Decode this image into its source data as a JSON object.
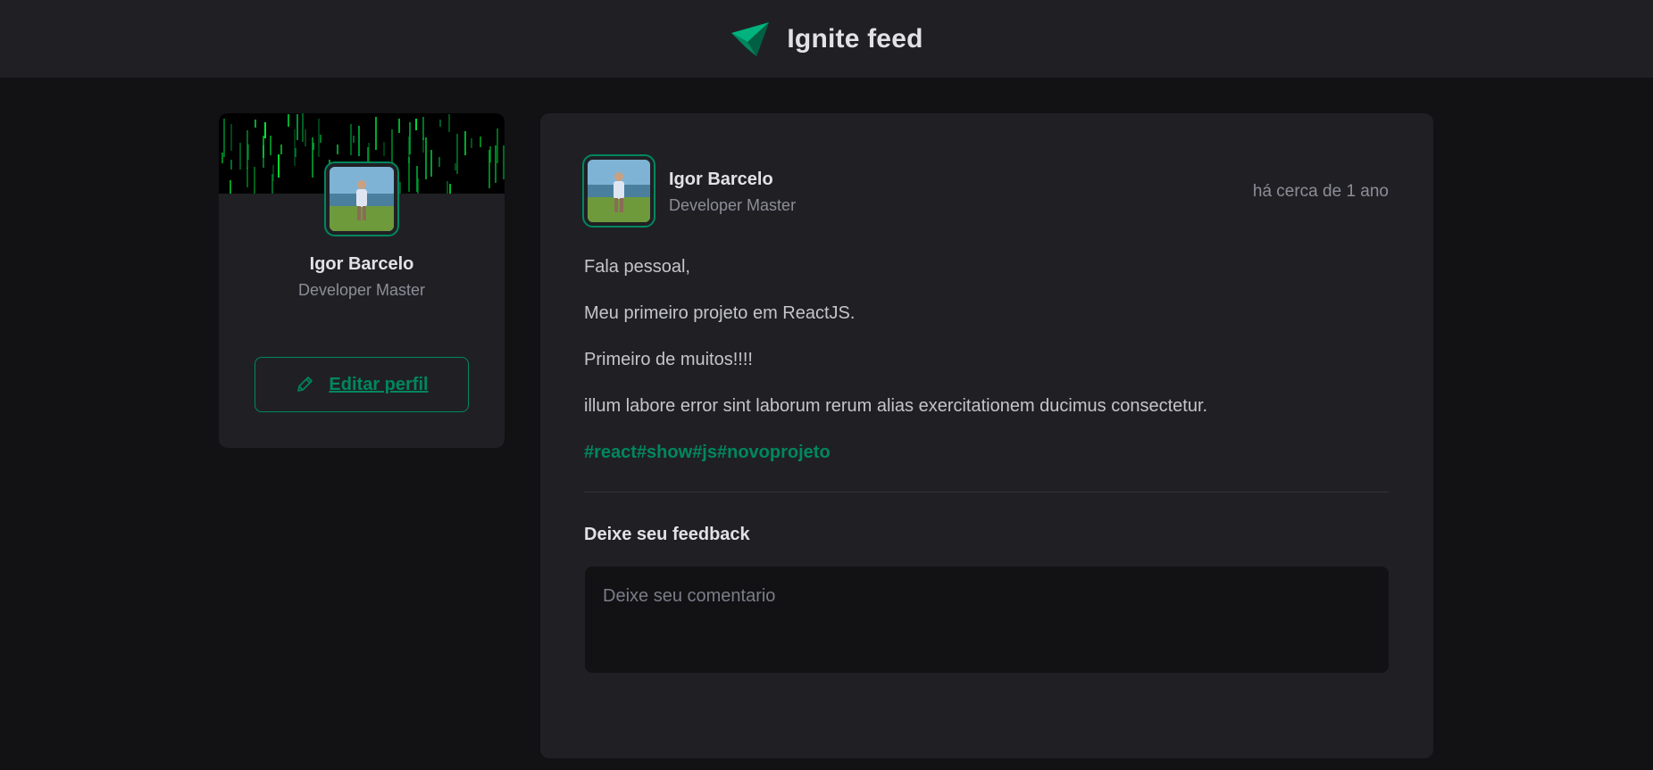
{
  "header": {
    "title": "Ignite feed",
    "logo_icon": "paper-plane-icon",
    "accent": "#00b37e"
  },
  "sidebar": {
    "profile_name": "Igor Barcelo",
    "profile_role": "Developer Master",
    "edit_button_label": "Editar perfil",
    "edit_icon": "pencil-icon"
  },
  "post": {
    "author_name": "Igor Barcelo",
    "author_role": "Developer Master",
    "published_ago": "há cerca de 1 ano",
    "paragraphs": [
      "Fala pessoal,",
      "Meu primeiro projeto em ReactJS.",
      "Primeiro de muitos!!!!",
      "illum labore error sint laborum rerum alias exercitationem ducimus consectetur."
    ],
    "hashtags": [
      "#react",
      "#show",
      "#js",
      "#novoprojeto"
    ]
  },
  "feedback": {
    "title": "Deixe seu feedback",
    "placeholder": "Deixe seu comentario",
    "value": ""
  },
  "colors": {
    "brand_green": "#00875f",
    "background": "#121214",
    "surface": "#202024",
    "text_muted": "#8d8d99"
  }
}
